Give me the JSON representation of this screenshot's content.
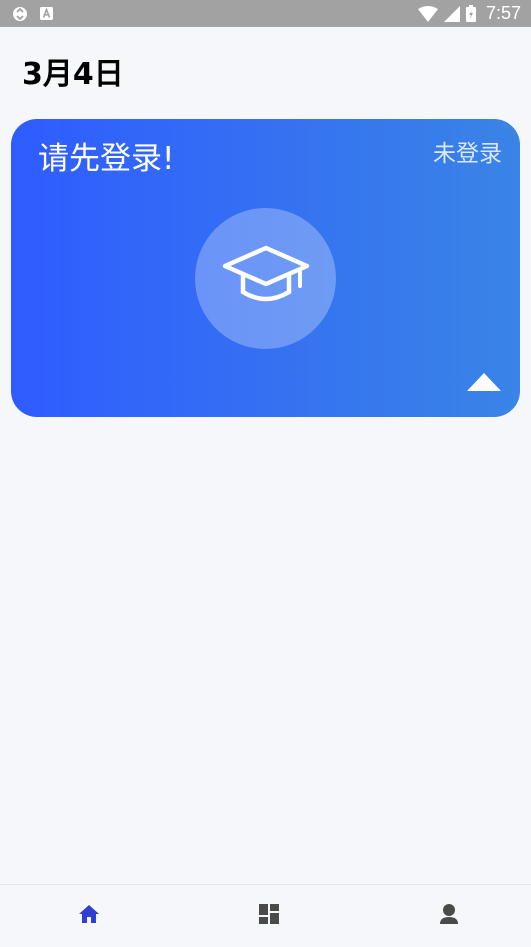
{
  "status_bar": {
    "time": "7:57",
    "icons": [
      "sync-icon",
      "a-badge-icon",
      "wifi-icon",
      "signal-icon",
      "battery-icon"
    ]
  },
  "header": {
    "date": "3月4日"
  },
  "login_card": {
    "title": "请先登录!",
    "status": "未登录",
    "avatar_icon": "graduation-cap-icon",
    "expand_icon": "triangle-up-icon",
    "gradient_start": "#2f5cff",
    "gradient_end": "#3a84e6"
  },
  "bottom_nav": {
    "items": [
      {
        "icon": "home-icon",
        "active": true,
        "color": "#2f3fcf"
      },
      {
        "icon": "dashboard-icon",
        "active": false,
        "color": "#4a4a4a"
      },
      {
        "icon": "user-icon",
        "active": false,
        "color": "#4a4a4a"
      }
    ]
  }
}
